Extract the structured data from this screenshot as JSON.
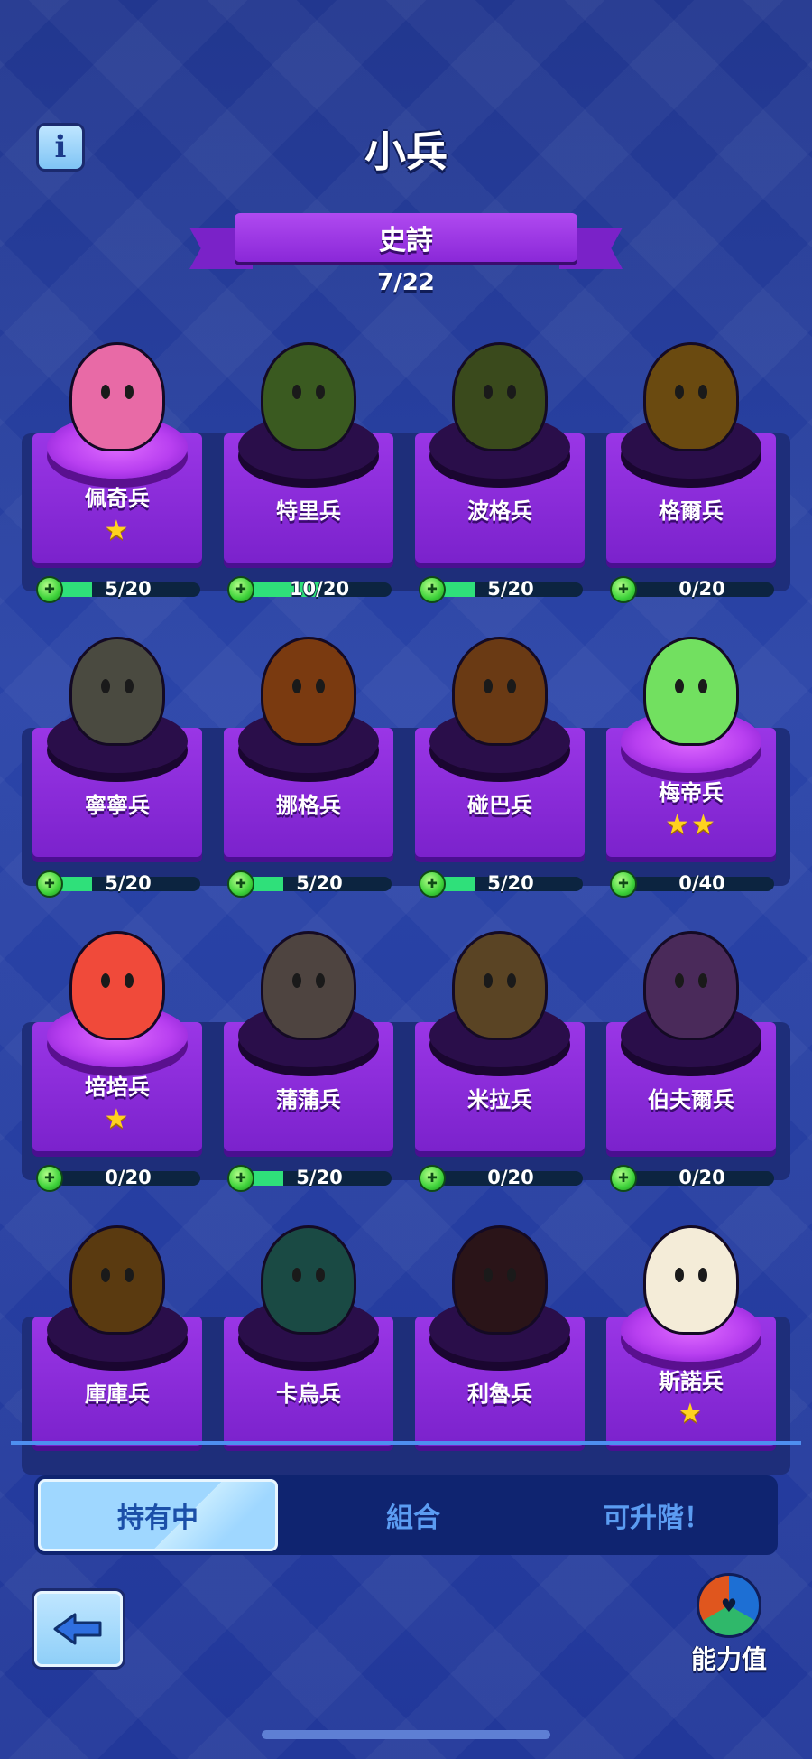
{
  "header": {
    "title": "小兵",
    "info_icon": "info-icon"
  },
  "category": {
    "label": "史詩",
    "counter": "7/22"
  },
  "minions": [
    {
      "name": "佩奇兵",
      "stars": "★",
      "progress": "5/20",
      "fill": 0.25,
      "owned": true,
      "color": "#e86aa6"
    },
    {
      "name": "特里兵",
      "stars": "",
      "progress": "10/20",
      "fill": 0.5,
      "owned": false,
      "color": "#3a5a20"
    },
    {
      "name": "波格兵",
      "stars": "",
      "progress": "5/20",
      "fill": 0.25,
      "owned": false,
      "color": "#3a4a1c"
    },
    {
      "name": "格爾兵",
      "stars": "",
      "progress": "0/20",
      "fill": 0,
      "owned": false,
      "color": "#6a4a10"
    },
    {
      "name": "寧寧兵",
      "stars": "",
      "progress": "5/20",
      "fill": 0.25,
      "owned": false,
      "color": "#4a4a40"
    },
    {
      "name": "挪格兵",
      "stars": "",
      "progress": "5/20",
      "fill": 0.25,
      "owned": false,
      "color": "#7a3a10"
    },
    {
      "name": "碰巴兵",
      "stars": "",
      "progress": "5/20",
      "fill": 0.25,
      "owned": false,
      "color": "#6a3a14"
    },
    {
      "name": "梅帝兵",
      "stars": "★★",
      "progress": "0/40",
      "fill": 0,
      "owned": true,
      "color": "#72e060"
    },
    {
      "name": "培培兵",
      "stars": "★",
      "progress": "0/20",
      "fill": 0,
      "owned": true,
      "color": "#f04a3a"
    },
    {
      "name": "蒲蒲兵",
      "stars": "",
      "progress": "5/20",
      "fill": 0.25,
      "owned": false,
      "color": "#4e4440"
    },
    {
      "name": "米拉兵",
      "stars": "",
      "progress": "0/20",
      "fill": 0,
      "owned": false,
      "color": "#5a4424"
    },
    {
      "name": "伯夫爾兵",
      "stars": "",
      "progress": "0/20",
      "fill": 0,
      "owned": false,
      "color": "#4a2a5a"
    },
    {
      "name": "庫庫兵",
      "stars": "",
      "progress": "",
      "fill": 0,
      "owned": false,
      "color": "#5a3a10"
    },
    {
      "name": "卡烏兵",
      "stars": "",
      "progress": "",
      "fill": 0,
      "owned": false,
      "color": "#1a4a44"
    },
    {
      "name": "利魯兵",
      "stars": "",
      "progress": "",
      "fill": 0,
      "owned": false,
      "color": "#2a1418"
    },
    {
      "name": "斯諾兵",
      "stars": "★",
      "progress": "",
      "fill": 0,
      "owned": true,
      "color": "#f4ecd8"
    }
  ],
  "tabs": [
    {
      "label": "持有中",
      "active": true
    },
    {
      "label": "組合",
      "active": false
    },
    {
      "label": "可升階！",
      "active": false
    }
  ],
  "footer": {
    "back_icon": "arrow-left-icon",
    "stats_label": "能力值",
    "stats_icon": "stats-wheel-icon"
  },
  "colors": {
    "background": "#263a96",
    "card": "#8a2cd8",
    "progress_fill": "#2fe07a",
    "star": "#ffd21f"
  }
}
